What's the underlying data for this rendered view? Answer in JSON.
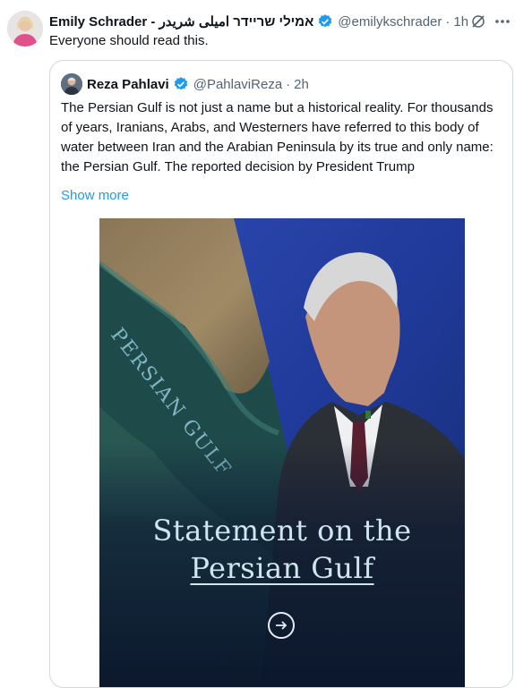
{
  "post": {
    "author_name": "Emily Schrader - אמילי שריידר امیلی شریدر",
    "handle": "@emilykschrader",
    "separator": "·",
    "time": "1h",
    "text": "Everyone should read this."
  },
  "quote": {
    "author_name": "Reza Pahlavi",
    "handle": "@PahlaviReza",
    "separator": "·",
    "time": "2h",
    "text": "The Persian Gulf is not just a name but a historical reality. For thousands of years, Iranians, Arabs, and Westerners have referred to this body of water between Iran and the Arabian Peninsula by its true and only name: the Persian Gulf. The reported decision by President Trump",
    "show_more": "Show more",
    "media": {
      "map_label": "PERSIAN GULF",
      "title_line1": "Statement on the",
      "title_line2": "Persian Gulf"
    }
  },
  "colors": {
    "link": "#1d9bf0",
    "verified": "#1d9bf0",
    "secondary_text": "#536471",
    "border": "#cfd9de"
  },
  "icons": {
    "verified": "verified-badge-icon",
    "grok": "grok-icon",
    "more": "more-options-icon",
    "next": "arrow-right-icon"
  }
}
